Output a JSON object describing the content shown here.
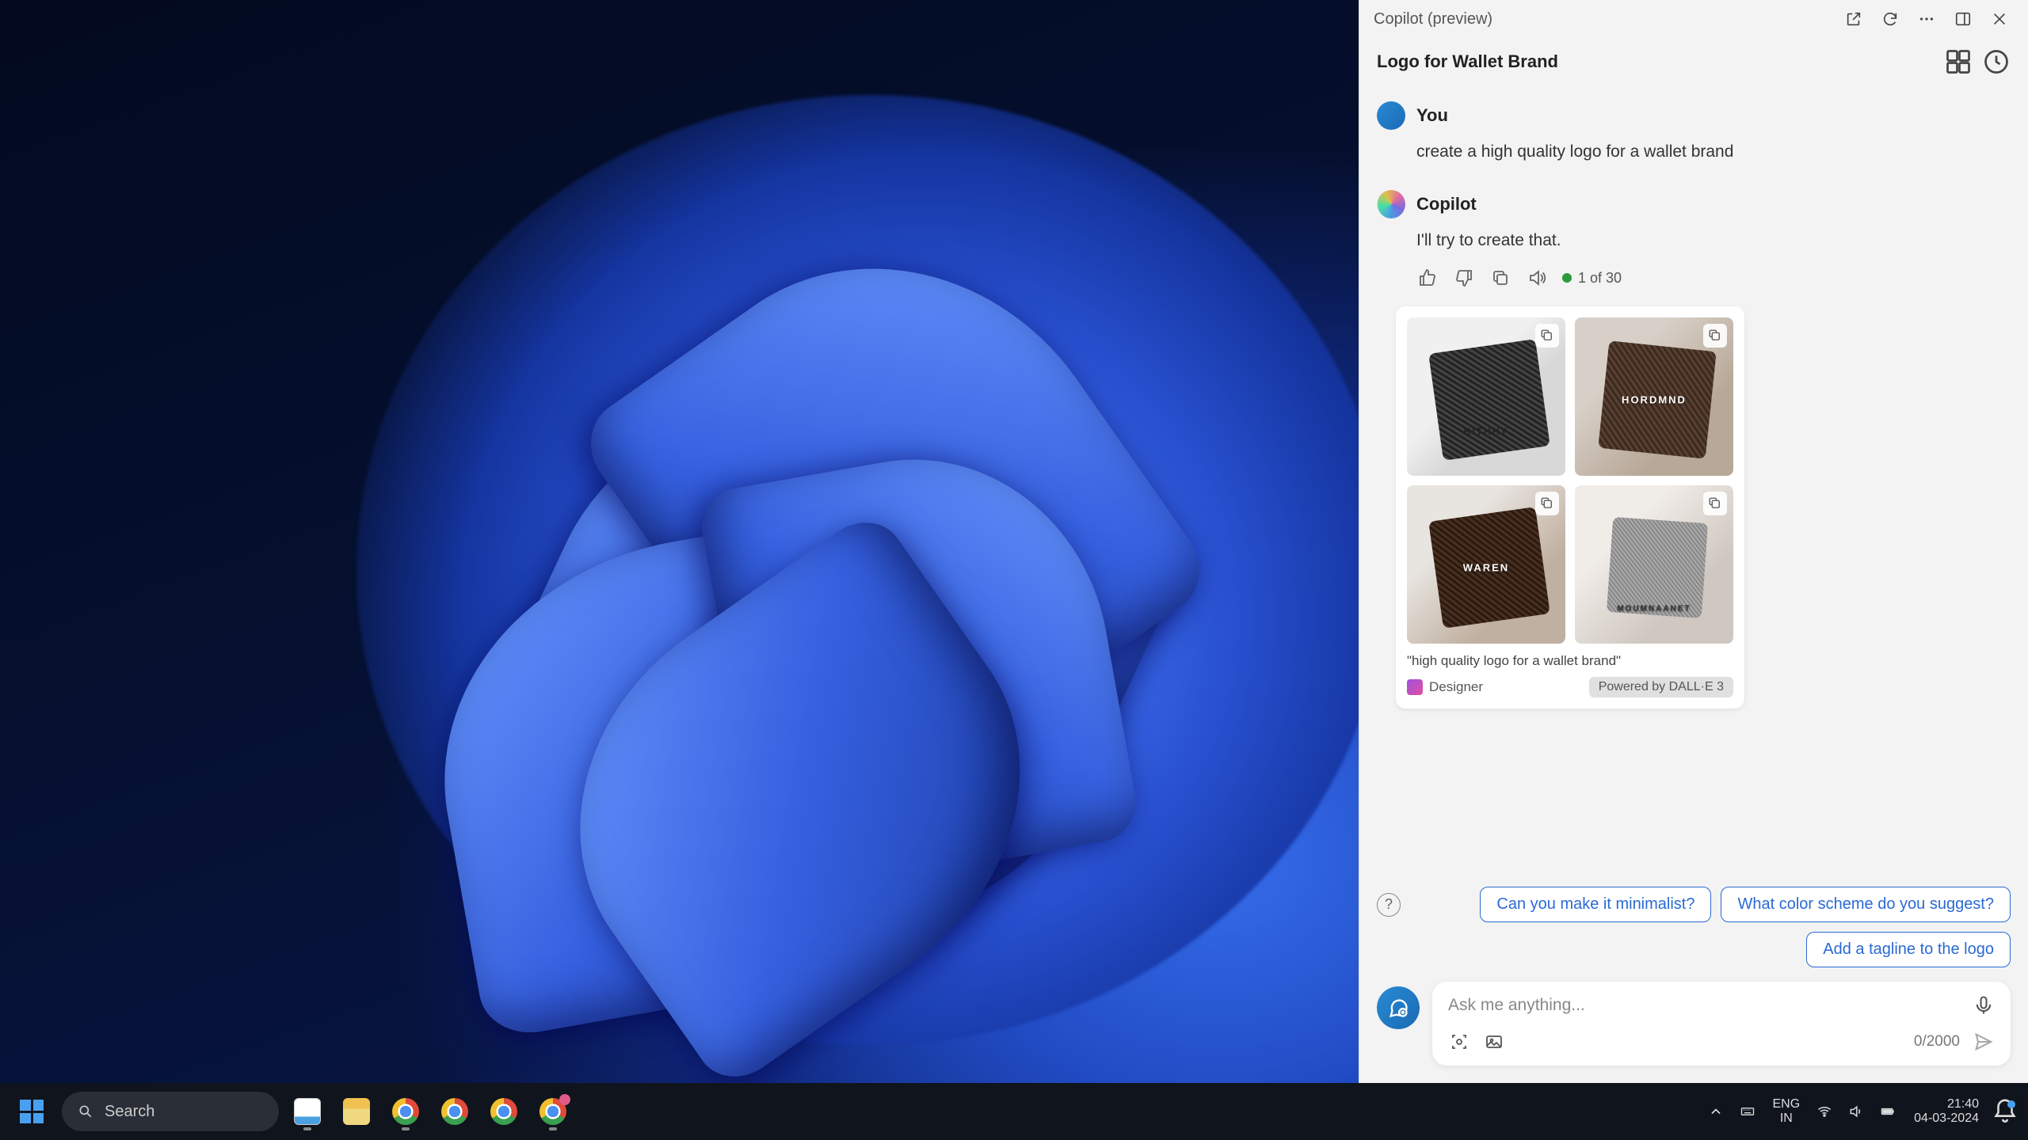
{
  "copilot": {
    "header_title": "Copilot (preview)",
    "topic_title": "Logo for Wallet Brand",
    "user_name": "You",
    "user_message": "create a high quality logo for a wallet brand",
    "copilot_name": "Copilot",
    "copilot_message": "I'll try to create that.",
    "counter": "1 of 30",
    "image_caption": "\"high quality logo for a wallet brand\"",
    "designer_label": "Designer",
    "powered_label": "Powered by DALL·E 3",
    "images": [
      {
        "label": "HITHHY"
      },
      {
        "label": "HORDMND"
      },
      {
        "label": "WAREN"
      },
      {
        "label": "MOUMNAANET"
      }
    ],
    "suggestions": [
      "Can you make it minimalist?",
      "What color scheme do you suggest?",
      "Add a tagline to the logo"
    ],
    "input_placeholder": "Ask me anything...",
    "char_count": "0/2000"
  },
  "taskbar": {
    "search_placeholder": "Search",
    "lang_top": "ENG",
    "lang_bottom": "IN",
    "time": "21:40",
    "date": "04-03-2024"
  }
}
